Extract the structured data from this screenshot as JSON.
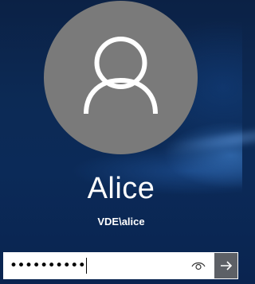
{
  "user": {
    "display_name": "Alice",
    "account": "VDE\\alice"
  },
  "password_field": {
    "masked_value": "••••••••••"
  },
  "icons": {
    "avatar": "person-icon",
    "reveal": "eye-icon",
    "submit": "arrow-right-icon"
  },
  "colors": {
    "background": "#0c2a55",
    "avatar_circle": "#7a7a7a",
    "submit_button": "#5d6066",
    "text": "#ffffff"
  }
}
